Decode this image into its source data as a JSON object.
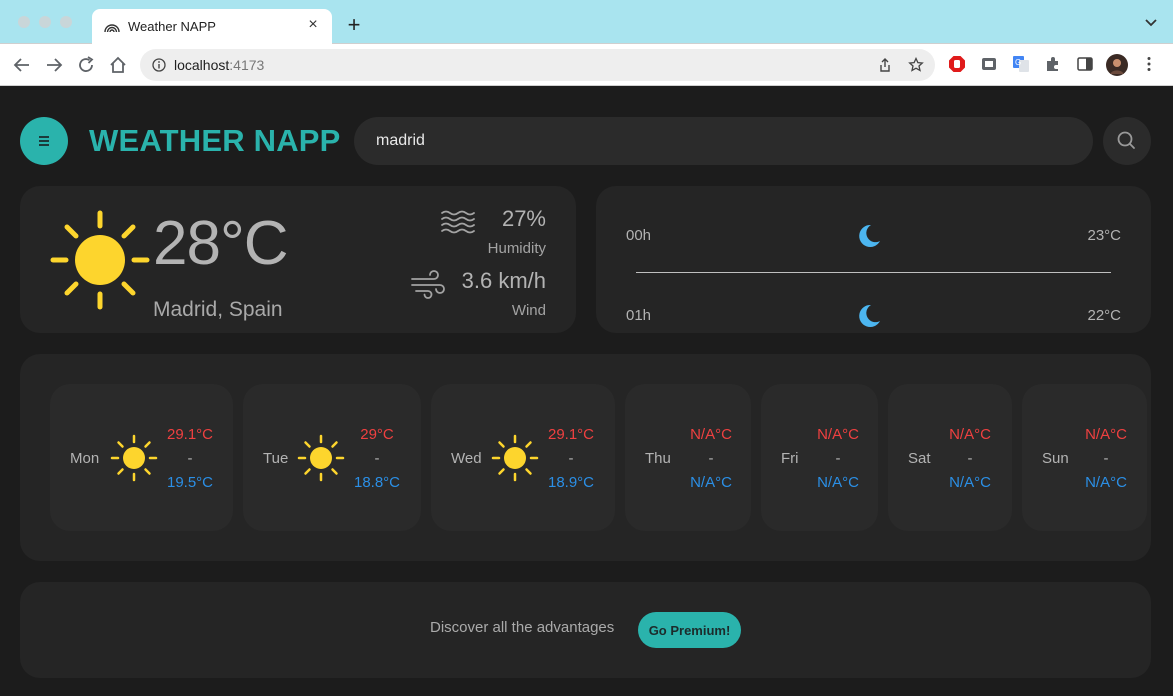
{
  "browser": {
    "tab_title": "Weather NAPP",
    "tab_close": "×",
    "new_tab": "+",
    "url_host": "localhost",
    "url_port": ":4173"
  },
  "app": {
    "title": "WEATHER NAPP",
    "search_value": "madrid",
    "accent_color": "#2ab3ac"
  },
  "current": {
    "icon": "sun-icon",
    "temperature": "28°C",
    "location": "Madrid, Spain",
    "humidity_value": "27%",
    "humidity_label": "Humidity",
    "wind_value": "3.6 km/h",
    "wind_label": "Wind"
  },
  "hourly": [
    {
      "time": "00h",
      "icon": "moon-icon",
      "temp": "23°C"
    },
    {
      "time": "01h",
      "icon": "moon-icon",
      "temp": "22°C"
    }
  ],
  "weekly": [
    {
      "day": "Mon",
      "icon": "sun-icon",
      "max": "29.1°C",
      "sep": "-",
      "min": "19.5°C"
    },
    {
      "day": "Tue",
      "icon": "sun-icon",
      "max": "29°C",
      "sep": "-",
      "min": "18.8°C"
    },
    {
      "day": "Wed",
      "icon": "sun-icon",
      "max": "29.1°C",
      "sep": "-",
      "min": "18.9°C"
    },
    {
      "day": "Thu",
      "icon": "",
      "max": "N/A°C",
      "sep": "-",
      "min": "N/A°C"
    },
    {
      "day": "Fri",
      "icon": "",
      "max": "N/A°C",
      "sep": "-",
      "min": "N/A°C"
    },
    {
      "day": "Sat",
      "icon": "",
      "max": "N/A°C",
      "sep": "-",
      "min": "N/A°C"
    },
    {
      "day": "Sun",
      "icon": "",
      "max": "N/A°C",
      "sep": "-",
      "min": "N/A°C"
    }
  ],
  "promo": {
    "text": "Discover all the advantages",
    "button": "Go Premium!"
  },
  "colors": {
    "max_temp": "#ef4040",
    "min_temp": "#2b8fe6",
    "sun": "#fdd52d",
    "moon": "#4cb6f0"
  }
}
